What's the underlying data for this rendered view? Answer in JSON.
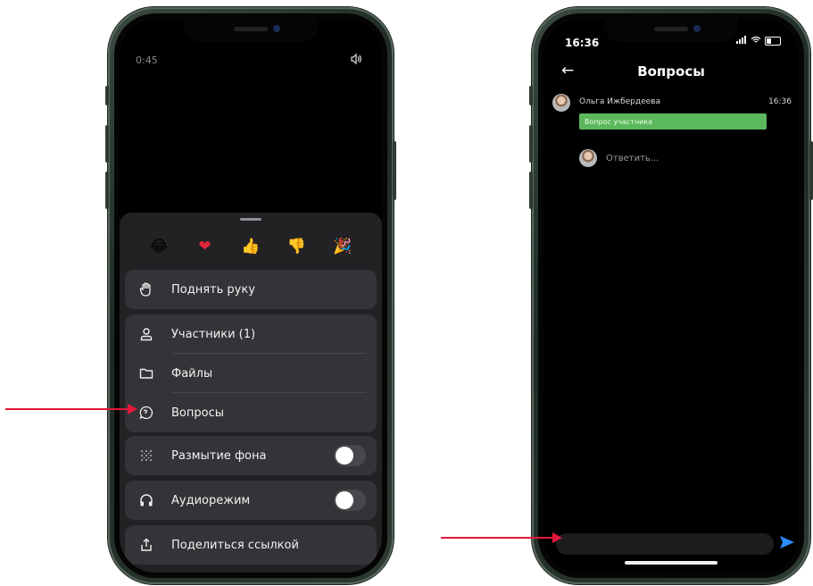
{
  "left_phone": {
    "call_time": "0:45",
    "reactions": [
      {
        "icon": "laughing-emoji-icon",
        "glyph": "😂"
      },
      {
        "icon": "heart-emoji-icon",
        "glyph": "❤"
      },
      {
        "icon": "thumbs-up-emoji-icon",
        "glyph": "👍"
      },
      {
        "icon": "thumbs-down-emoji-icon",
        "glyph": "👎"
      },
      {
        "icon": "party-popper-emoji-icon",
        "glyph": "🎉"
      }
    ],
    "menu": {
      "raise_hand": "Поднять руку",
      "participants": "Участники (1)",
      "files": "Файлы",
      "questions": "Вопросы",
      "blur_background": "Размытие фона",
      "audio_mode": "Аудиорежим",
      "share_link": "Поделиться ссылкой"
    },
    "toggles": {
      "blur_background": false,
      "audio_mode": false
    }
  },
  "right_phone": {
    "status_time": "16:36",
    "title": "Вопросы",
    "message": {
      "author": "Ольга Ижбердеева",
      "time": "16:36",
      "text": "Вопрос участника"
    },
    "reply_placeholder": "Ответить..."
  },
  "annotation_color": "#e3173a"
}
